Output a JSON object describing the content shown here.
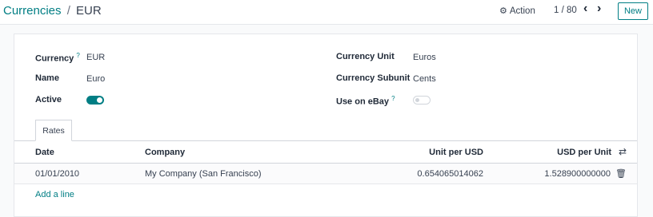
{
  "breadcrumb": {
    "parent": "Currencies",
    "separator": "/",
    "current": "EUR"
  },
  "toolbar": {
    "action_label": "Action",
    "pager": "1 / 80",
    "new_label": "New"
  },
  "form": {
    "left": [
      {
        "label": "Currency",
        "help": "?",
        "value": "EUR"
      },
      {
        "label": "Name",
        "value": "Euro"
      },
      {
        "label": "Active",
        "toggle": true
      }
    ],
    "right": [
      {
        "label": "Currency Unit",
        "value": "Euros"
      },
      {
        "label": "Currency Subunit",
        "value": "Cents"
      },
      {
        "label": "Use on eBay",
        "help": "?",
        "toggle": false
      }
    ]
  },
  "tabs": [
    {
      "label": "Rates",
      "active": true
    }
  ],
  "rates_table": {
    "columns": [
      "Date",
      "Company",
      "Unit per USD",
      "USD per Unit"
    ],
    "rows": [
      {
        "date": "01/01/2010",
        "company": "My Company (San Francisco)",
        "unit_per_usd": "0.654065014062",
        "usd_per_unit": "1.528900000000"
      }
    ],
    "add_line_label": "Add a line"
  },
  "colors": {
    "accent": "#017e84",
    "text": "#374151"
  },
  "icons": {
    "gear": "gear-icon",
    "prev": "chevron-left-icon",
    "next": "chevron-right-icon",
    "trash": "trash-icon",
    "column_settings": "sliders-icon"
  }
}
